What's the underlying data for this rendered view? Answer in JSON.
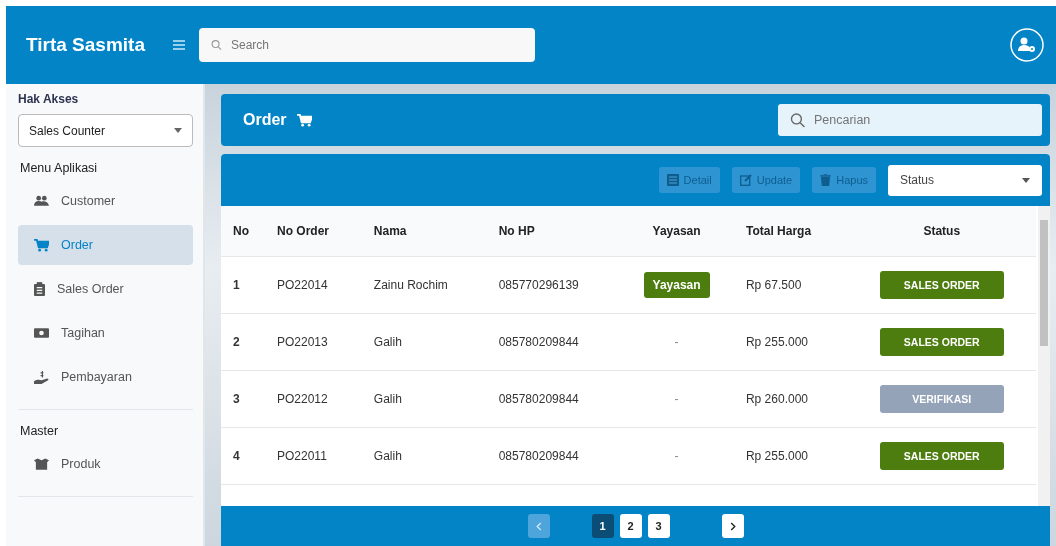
{
  "topbar": {
    "brand": "Tirta Sasmita",
    "search": {
      "placeholder": "Search"
    }
  },
  "sidebar": {
    "access_label": "Hak Akses",
    "access_value": "Sales Counter",
    "sections": [
      {
        "title": "Menu Aplikasi",
        "items": [
          {
            "label": "Customer",
            "selected": false
          },
          {
            "label": "Order",
            "selected": true
          },
          {
            "label": "Sales Order",
            "selected": false
          },
          {
            "label": "Tagihan",
            "selected": false
          },
          {
            "label": "Pembayaran",
            "selected": false
          }
        ]
      },
      {
        "title": "Master",
        "items": [
          {
            "label": "Produk",
            "selected": false
          }
        ]
      }
    ]
  },
  "page_header": {
    "title": "Order",
    "search": {
      "placeholder": "Pencarian"
    }
  },
  "toolbar": {
    "buttons": [
      {
        "label": "Detail",
        "disabled": true
      },
      {
        "label": "Update",
        "disabled": true
      },
      {
        "label": "Hapus",
        "disabled": true
      }
    ],
    "status_select": {
      "placeholder": "Status"
    }
  },
  "table": {
    "columns": [
      "No",
      "No Order",
      "Nama",
      "No HP",
      "Yayasan",
      "Total Harga",
      "Status"
    ],
    "rows": [
      {
        "no": "1",
        "order": "PO22014",
        "nama": "Zainu Rochim",
        "hp": "085770296139",
        "yayasan": {
          "kind": "badge",
          "label": "Yayasan"
        },
        "total": "Rp 67.500",
        "status": {
          "label": "SALES ORDER",
          "color": "#4d7c0f"
        }
      },
      {
        "no": "2",
        "order": "PO22013",
        "nama": "Galih",
        "hp": "085780209844",
        "yayasan": {
          "kind": "text",
          "label": "-"
        },
        "total": "Rp 255.000",
        "status": {
          "label": "SALES ORDER",
          "color": "#4d7c0f"
        }
      },
      {
        "no": "3",
        "order": "PO22012",
        "nama": "Galih",
        "hp": "085780209844",
        "yayasan": {
          "kind": "text",
          "label": "-"
        },
        "total": "Rp 260.000",
        "status": {
          "label": "VERIFIKASI",
          "color": "#94a3b8"
        }
      },
      {
        "no": "4",
        "order": "PO22011",
        "nama": "Galih",
        "hp": "085780209844",
        "yayasan": {
          "kind": "text",
          "label": "-"
        },
        "total": "Rp 255.000",
        "status": {
          "label": "SALES ORDER",
          "color": "#4d7c0f"
        }
      }
    ]
  },
  "pagination": {
    "prev_disabled": true,
    "pages": [
      {
        "label": "1",
        "selected": true
      },
      {
        "label": "2",
        "selected": false
      },
      {
        "label": "3",
        "selected": false
      }
    ]
  }
}
